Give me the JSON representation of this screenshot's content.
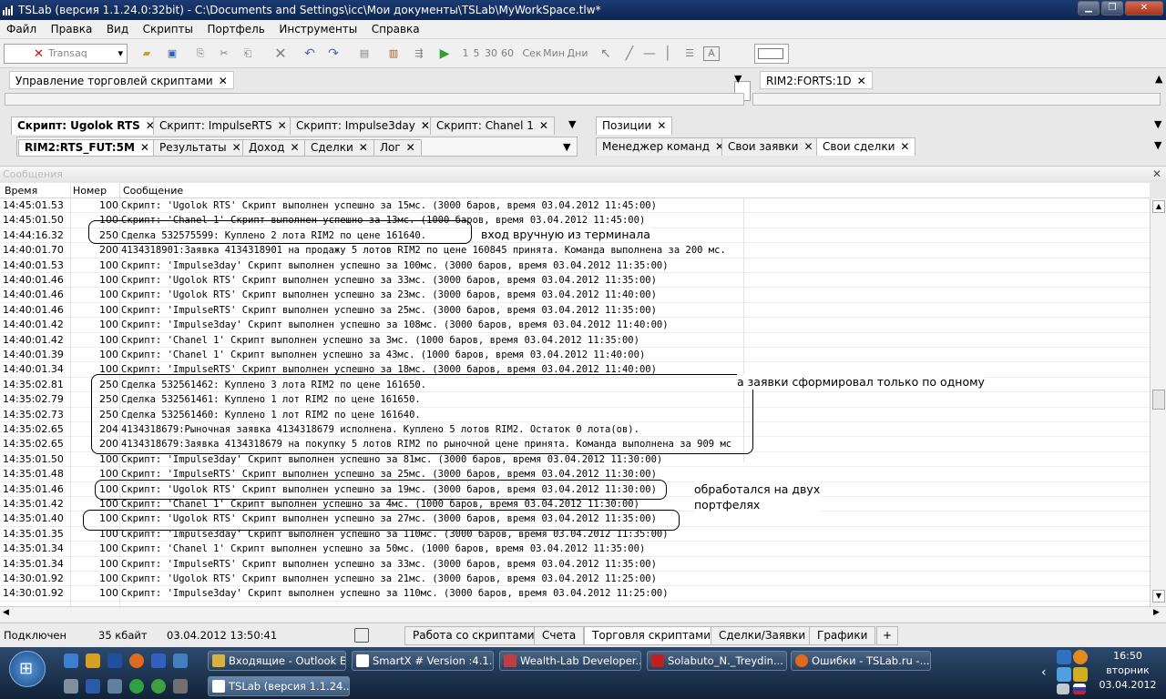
{
  "window": {
    "title": "TSLab (версия 1.1.24.0:32bit) - C:\\Documents and Settings\\icc\\Мои документы\\TSLab\\MyWorkSpace.tlw*"
  },
  "menu": [
    "Файл",
    "Правка",
    "Вид",
    "Скрипты",
    "Портфель",
    "Инструменты",
    "Справка"
  ],
  "toolbar": {
    "connector": "Transaq",
    "intervals": [
      "1",
      "5",
      "30",
      "60",
      "Сек",
      "Мин",
      "Дни"
    ]
  },
  "panels": {
    "script_manager_tab": "Управление торговлей скриптами",
    "chart_tab": "RIM2:FORTS:1D",
    "script_tabs": [
      "Скрипт: Ugolok RTS",
      "Скрипт: ImpulseRTS",
      "Скрипт: Impulse3day",
      "Скрипт: Chanel 1"
    ],
    "sub_tabs": [
      "RIM2:RTS_FUT:5M",
      "Результаты",
      "Доход",
      "Сделки",
      "Лог"
    ],
    "right_tabs_top": [
      "Позиции"
    ],
    "right_tabs_bottom": [
      "Менеджер команд",
      "Свои заявки",
      "Свои сделки"
    ]
  },
  "messages": {
    "title": "Сообщения",
    "columns": {
      "time": "Время",
      "number": "Номер",
      "message": "Сообщение"
    },
    "rows": [
      {
        "t": "14:45:01.53",
        "n": "100",
        "m": "Скрипт: 'Ugolok RTS' Скрипт выполнен успешно за 15мс. (3000 баров, время 03.04.2012 11:45:00)"
      },
      {
        "t": "14:45:01.50",
        "n": "100",
        "m": "Скрипт: 'Chanel 1' Скрипт выполнен успешно за 13мс. (1000 баров, время 03.04.2012 11:45:00)"
      },
      {
        "t": "14:44:16.32",
        "n": "250",
        "m": "Сделка 532575599: Куплено 2 лота RIM2 по цене 161640."
      },
      {
        "t": "14:40:01.70",
        "n": "200",
        "m": "4134318901:Заявка 4134318901 на продажу 5 лотов RIM2 по цене 160845 принята. Команда выполнена за 200 мс."
      },
      {
        "t": "14:40:01.53",
        "n": "100",
        "m": "Скрипт: 'Impulse3day' Скрипт выполнен успешно за 100мс. (3000 баров, время 03.04.2012 11:35:00)"
      },
      {
        "t": "14:40:01.46",
        "n": "100",
        "m": "Скрипт: 'Ugolok RTS' Скрипт выполнен успешно за 33мс. (3000 баров, время 03.04.2012 11:35:00)"
      },
      {
        "t": "14:40:01.46",
        "n": "100",
        "m": "Скрипт: 'Ugolok RTS' Скрипт выполнен успешно за 23мс. (3000 баров, время 03.04.2012 11:40:00)"
      },
      {
        "t": "14:40:01.46",
        "n": "100",
        "m": "Скрипт: 'ImpulseRTS' Скрипт выполнен успешно за 25мс. (3000 баров, время 03.04.2012 11:35:00)"
      },
      {
        "t": "14:40:01.42",
        "n": "100",
        "m": "Скрипт: 'Impulse3day' Скрипт выполнен успешно за 108мс. (3000 баров, время 03.04.2012 11:40:00)"
      },
      {
        "t": "14:40:01.42",
        "n": "100",
        "m": "Скрипт: 'Chanel 1' Скрипт выполнен успешно за 3мс. (1000 баров, время 03.04.2012 11:35:00)"
      },
      {
        "t": "14:40:01.39",
        "n": "100",
        "m": "Скрипт: 'Chanel 1' Скрипт выполнен успешно за 43мс. (1000 баров, время 03.04.2012 11:40:00)"
      },
      {
        "t": "14:40:01.34",
        "n": "100",
        "m": "Скрипт: 'ImpulseRTS' Скрипт выполнен успешно за 18мс. (3000 баров, время 03.04.2012 11:40:00)"
      },
      {
        "t": "14:35:02.81",
        "n": "250",
        "m": "Сделка 532561462: Куплено 3 лота RIM2 по цене 161650."
      },
      {
        "t": "14:35:02.79",
        "n": "250",
        "m": "Сделка 532561461: Куплено 1 лот RIM2 по цене 161650."
      },
      {
        "t": "14:35:02.73",
        "n": "250",
        "m": "Сделка 532561460: Куплено 1 лот RIM2 по цене 161640."
      },
      {
        "t": "14:35:02.65",
        "n": "204",
        "m": "4134318679:Рыночная заявка 4134318679 исполнена. Куплено 5 лотов RIM2. Остаток 0 лота(ов)."
      },
      {
        "t": "14:35:02.65",
        "n": "200",
        "m": "4134318679:Заявка 4134318679 на покупку 5 лотов RIM2 по рыночной цене принята. Команда выполнена за 909 мс"
      },
      {
        "t": "14:35:01.50",
        "n": "100",
        "m": "Скрипт: 'Impulse3day' Скрипт выполнен успешно за 81мс. (3000 баров, время 03.04.2012 11:30:00)"
      },
      {
        "t": "14:35:01.48",
        "n": "100",
        "m": "Скрипт: 'ImpulseRTS' Скрипт выполнен успешно за 25мс. (3000 баров, время 03.04.2012 11:30:00)"
      },
      {
        "t": "14:35:01.46",
        "n": "100",
        "m": "Скрипт: 'Ugolok RTS' Скрипт выполнен успешно за 19мс. (3000 баров, время 03.04.2012 11:30:00)"
      },
      {
        "t": "14:35:01.42",
        "n": "100",
        "m": "Скрипт: 'Chanel 1' Скрипт выполнен успешно за 4мс. (1000 баров, время 03.04.2012 11:30:00)"
      },
      {
        "t": "14:35:01.40",
        "n": "100",
        "m": "Скрипт: 'Ugolok RTS' Скрипт выполнен успешно за 27мс. (3000 баров, время 03.04.2012 11:35:00)"
      },
      {
        "t": "14:35:01.35",
        "n": "100",
        "m": "Скрипт: 'Impulse3day' Скрипт выполнен успешно за 110мс. (3000 баров, время 03.04.2012 11:35:00)"
      },
      {
        "t": "14:35:01.34",
        "n": "100",
        "m": "Скрипт: 'Chanel 1' Скрипт выполнен успешно за 50мс. (1000 баров, время 03.04.2012 11:35:00)"
      },
      {
        "t": "14:35:01.34",
        "n": "100",
        "m": "Скрипт: 'ImpulseRTS' Скрипт выполнен успешно за 33мс. (3000 баров, время 03.04.2012 11:35:00)"
      },
      {
        "t": "14:30:01.92",
        "n": "100",
        "m": "Скрипт: 'Ugolok RTS' Скрипт выполнен успешно за 21мс. (3000 баров, время 03.04.2012 11:25:00)"
      },
      {
        "t": "14:30:01.92",
        "n": "100",
        "m": "Скрипт: 'Impulse3day' Скрипт выполнен успешно за 110мс. (3000 баров, время 03.04.2012 11:25:00)"
      }
    ]
  },
  "annotations": {
    "manual_entry": "вход вручную из терминала",
    "orders_one": "а заявки сформировал только по одному",
    "two_portfolios": [
      "обработался на двух",
      "портфелях"
    ]
  },
  "status": {
    "connection": "Подключен",
    "size": "35 кбайт",
    "datetime": "03.04.2012 13:50:41",
    "tabs": [
      "Работа со скриптами",
      "Счета",
      "Торговля скриптами",
      "Сделки/Заявки",
      "Графики",
      "+"
    ]
  },
  "taskbar": {
    "tasks": [
      "Входящие - Outlook E...",
      "SmartX # Version :4.1...",
      "Wealth-Lab Developer...",
      "Solabuto_N._Treydin...",
      "Ошибки - TSLab.ru -...",
      "TSLab (версия 1.1.24..."
    ],
    "clock": {
      "time": "16:50",
      "day": "вторник",
      "date": "03.04.2012"
    }
  },
  "colors": {
    "title_bar": "#1c3b74",
    "taskbar": "#1a3050"
  }
}
